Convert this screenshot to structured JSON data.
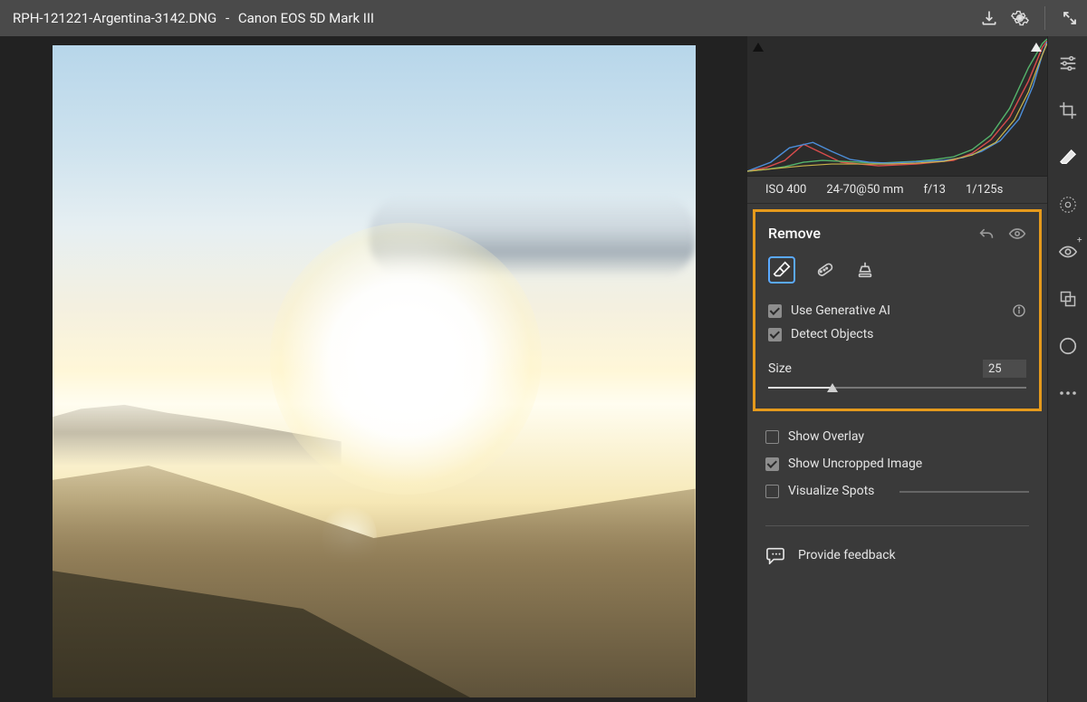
{
  "header": {
    "filename": "RPH-121221-Argentina-3142.DNG",
    "separator": "-",
    "camera": "Canon EOS 5D Mark III"
  },
  "meta": {
    "iso": "ISO 400",
    "lens": "24-70@50 mm",
    "aperture": "f/13",
    "shutter": "1/125s"
  },
  "remove": {
    "title": "Remove",
    "tool_selected": "eraser",
    "use_generative_ai": {
      "label": "Use Generative AI",
      "checked": true
    },
    "detect_objects": {
      "label": "Detect Objects",
      "checked": true
    },
    "size": {
      "label": "Size",
      "value": "25",
      "percent": 25
    }
  },
  "options": {
    "show_overlay": {
      "label": "Show Overlay",
      "checked": false
    },
    "show_uncropped": {
      "label": "Show Uncropped Image",
      "checked": true
    },
    "visualize_spots": {
      "label": "Visualize Spots",
      "checked": false
    }
  },
  "feedback": {
    "label": "Provide feedback"
  },
  "colors": {
    "highlight": "#e59a1c",
    "select": "#5aa9ff"
  }
}
